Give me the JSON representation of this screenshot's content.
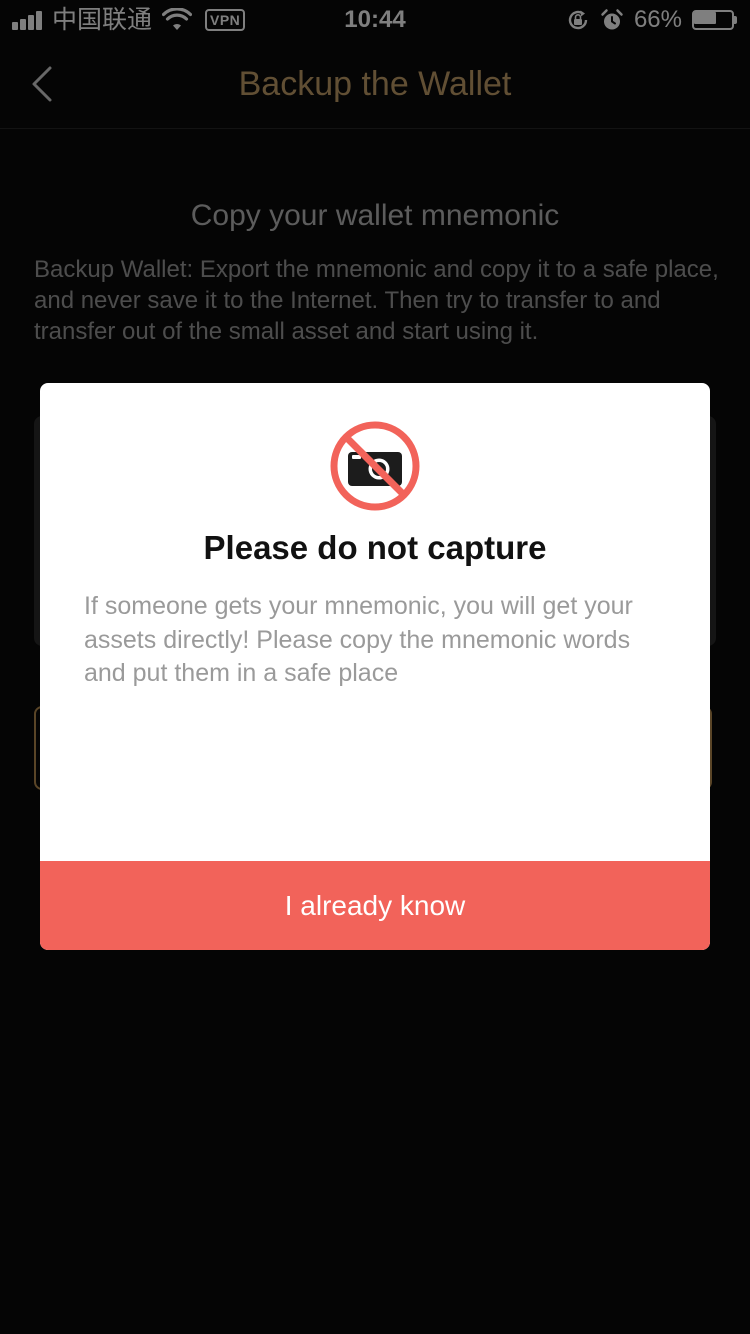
{
  "status_bar": {
    "carrier": "中国联通",
    "vpn_badge": "VPN",
    "time": "10:44",
    "battery_percent_label": "66%",
    "battery_level": 0.66,
    "icons": [
      "signal-icon",
      "wifi-icon",
      "orientation-lock-icon",
      "alarm-icon",
      "battery-icon"
    ]
  },
  "nav": {
    "title": "Backup the Wallet",
    "back_icon": "chevron-left-icon"
  },
  "content": {
    "section_title": "Copy your wallet mnemonic",
    "description": "Backup Wallet: Export the mnemonic and copy it to a safe place, and never save it to the Internet. Then try to transfer to and transfer out of the small asset and start using it."
  },
  "modal": {
    "icon": "no-camera-icon",
    "title": "Please do not capture",
    "body": "If someone gets your mnemonic, you will get your assets directly! Please copy the mnemonic words and put them in a safe place",
    "button_label": "I already know"
  },
  "colors": {
    "background": "#0a0a0a",
    "nav_title": "#c39e68",
    "accent_border": "#b58a4e",
    "modal_button": "#f2635a",
    "prohibit_red": "#f2635a"
  }
}
